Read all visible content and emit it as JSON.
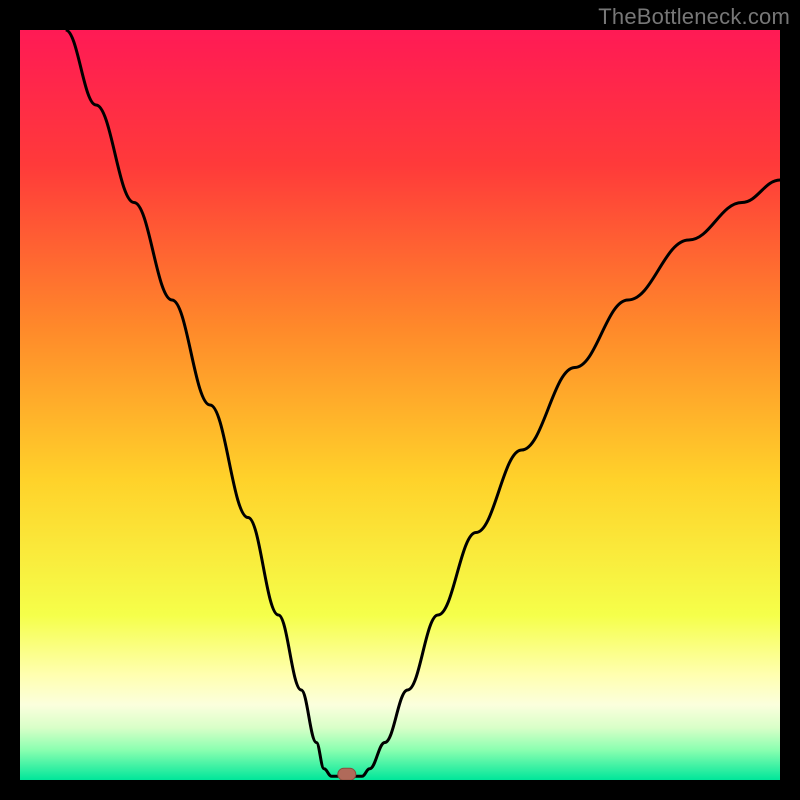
{
  "watermark": "TheBottleneck.com",
  "colors": {
    "black": "#000000",
    "curve": "#000000",
    "marker_fill": "#b06a5a",
    "marker_stroke": "#8a4a3c",
    "gradient_stops": [
      {
        "offset": "0%",
        "color": "#ff1a55"
      },
      {
        "offset": "18%",
        "color": "#ff3a3a"
      },
      {
        "offset": "40%",
        "color": "#ff8a2a"
      },
      {
        "offset": "60%",
        "color": "#ffd22a"
      },
      {
        "offset": "78%",
        "color": "#f5ff4a"
      },
      {
        "offset": "86%",
        "color": "#ffffb0"
      },
      {
        "offset": "90%",
        "color": "#fbffdd"
      },
      {
        "offset": "93%",
        "color": "#d9ffc8"
      },
      {
        "offset": "96%",
        "color": "#8affb0"
      },
      {
        "offset": "100%",
        "color": "#00e69a"
      }
    ]
  },
  "chart_data": {
    "type": "line",
    "title": "",
    "xlabel": "",
    "ylabel": "",
    "xlim": [
      0,
      100
    ],
    "ylim": [
      0,
      100
    ],
    "notes": "V-shaped bottleneck curve. Minimum near x≈43. Left branch starts at top-left (x≈6,y≈100), right branch ends at (x=100,y≈80). Red rounded marker at the minimum point (≈43, ≈0.5).",
    "marker": {
      "x": 43,
      "y": 0.5
    },
    "series": [
      {
        "name": "bottleneck-curve",
        "points": [
          {
            "x": 6,
            "y": 100
          },
          {
            "x": 10,
            "y": 90
          },
          {
            "x": 15,
            "y": 77
          },
          {
            "x": 20,
            "y": 64
          },
          {
            "x": 25,
            "y": 50
          },
          {
            "x": 30,
            "y": 35
          },
          {
            "x": 34,
            "y": 22
          },
          {
            "x": 37,
            "y": 12
          },
          {
            "x": 39,
            "y": 5
          },
          {
            "x": 40,
            "y": 1.5
          },
          {
            "x": 41,
            "y": 0.5
          },
          {
            "x": 45,
            "y": 0.5
          },
          {
            "x": 46,
            "y": 1.5
          },
          {
            "x": 48,
            "y": 5
          },
          {
            "x": 51,
            "y": 12
          },
          {
            "x": 55,
            "y": 22
          },
          {
            "x": 60,
            "y": 33
          },
          {
            "x": 66,
            "y": 44
          },
          {
            "x": 73,
            "y": 55
          },
          {
            "x": 80,
            "y": 64
          },
          {
            "x": 88,
            "y": 72
          },
          {
            "x": 95,
            "y": 77
          },
          {
            "x": 100,
            "y": 80
          }
        ]
      }
    ]
  }
}
